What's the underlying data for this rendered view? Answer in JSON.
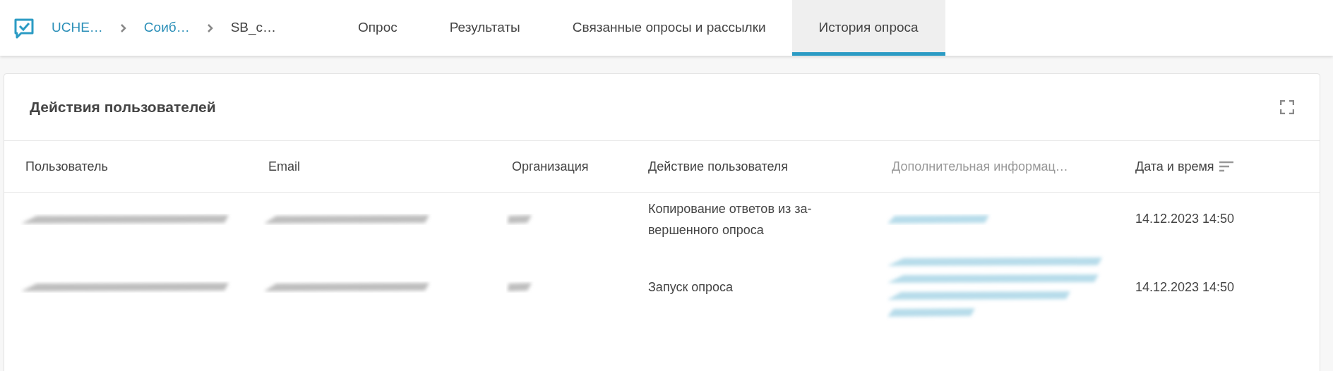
{
  "breadcrumbs": [
    {
      "label": "UCHE…",
      "link": true
    },
    {
      "label": "Соиб…",
      "link": true
    },
    {
      "label": "SB_c…",
      "link": false
    }
  ],
  "tabs": [
    {
      "label": "Опрос",
      "selected": false
    },
    {
      "label": "Результаты",
      "selected": false
    },
    {
      "label": "Связанные опросы и рассылки",
      "selected": false
    },
    {
      "label": "История опроса",
      "selected": true
    }
  ],
  "card": {
    "title": "Действия пользователей",
    "columns": [
      {
        "label": "Пользователь",
        "muted": false,
        "sort": false
      },
      {
        "label": "Email",
        "muted": false,
        "sort": false
      },
      {
        "label": "Организация",
        "muted": false,
        "sort": false
      },
      {
        "label": "Действие пользователя",
        "muted": false,
        "sort": false
      },
      {
        "label": "Дополнительная информац…",
        "muted": true,
        "sort": false
      },
      {
        "label": "Дата и время",
        "muted": false,
        "sort": true
      }
    ],
    "rows": [
      {
        "info": {
          "kind": "redacted-short"
        },
        "action": "Копирование ответов из за-\nвершенного опроса",
        "datetime": "14.12.2023 14:50"
      },
      {
        "info": {
          "kind": "redacted-long"
        },
        "action": "Запуск опроса",
        "datetime": "14.12.2023 14:50"
      }
    ]
  }
}
